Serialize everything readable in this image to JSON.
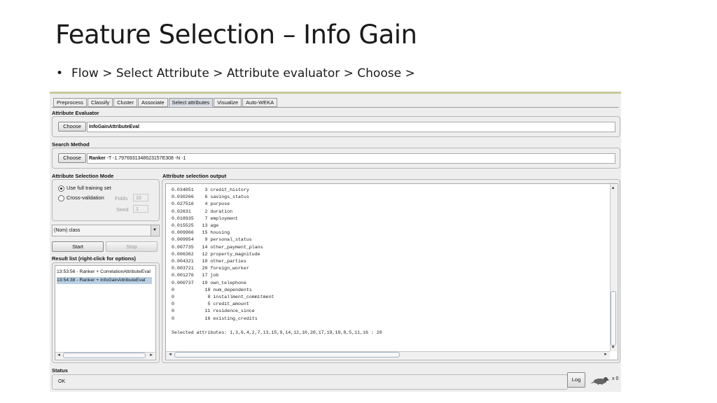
{
  "slide": {
    "title": "Feature Selection – Info Gain",
    "bullet": "Flow > Select Attribute > Attribute evaluator > Choose >"
  },
  "tabs": [
    "Preprocess",
    "Classify",
    "Cluster",
    "Associate",
    "Select attributes",
    "Visualize",
    "Auto-WEKA"
  ],
  "active_tab": "Select attributes",
  "evaluator": {
    "label": "Attribute Evaluator",
    "choose": "Choose",
    "value": "InfoGainAttributeEval"
  },
  "search": {
    "label": "Search Method",
    "choose": "Choose",
    "value_bold": "Ranker",
    "value_rest": " -T -1.7976931348623157E308 -N -1"
  },
  "mode": {
    "label": "Attribute Selection Mode",
    "use_full": "Use full training set",
    "cross": "Cross-validation",
    "folds_label": "Folds",
    "folds_value": "10",
    "seed_label": "Seed",
    "seed_value": "1"
  },
  "class_select": "(Nom) class",
  "start": "Start",
  "stop": "Stop",
  "result_list": {
    "label": "Result list (right-click for options)",
    "items": [
      "13:53:56 - Ranker + CorrelationAttributeEval",
      "13:54:38 - Ranker + InfoGainAttributeEval"
    ]
  },
  "output": {
    "label": "Attribute selection output",
    "lines": [
      "0.034051    3 credit_history",
      "0.030266    6 savings_status",
      "0.027516    4 purpose",
      "0.02631     2 duration",
      "0.018935    7 employment",
      "0.015525   13 age",
      "0.009966   15 housing",
      "0.009954    9 personal_status",
      "0.007735   14 other_payment_plans",
      "0.006362   12 property_magnitude",
      "0.004321   10 other_parties",
      "0.003721   20 foreign_worker",
      "0.001276   17 job",
      "0.000737   19 own_telephone",
      "0           18 num_dependents",
      "0            8 installment_commitment",
      "0            5 credit_amount",
      "0           11 residence_since",
      "0           16 existing_credits",
      "",
      "Selected attributes: 1,3,6,4,2,7,13,15,9,14,12,10,20,17,19,18,8,5,11,16 : 20"
    ]
  },
  "status": {
    "label": "Status",
    "value": "OK",
    "log": "Log",
    "count": "x 0"
  }
}
